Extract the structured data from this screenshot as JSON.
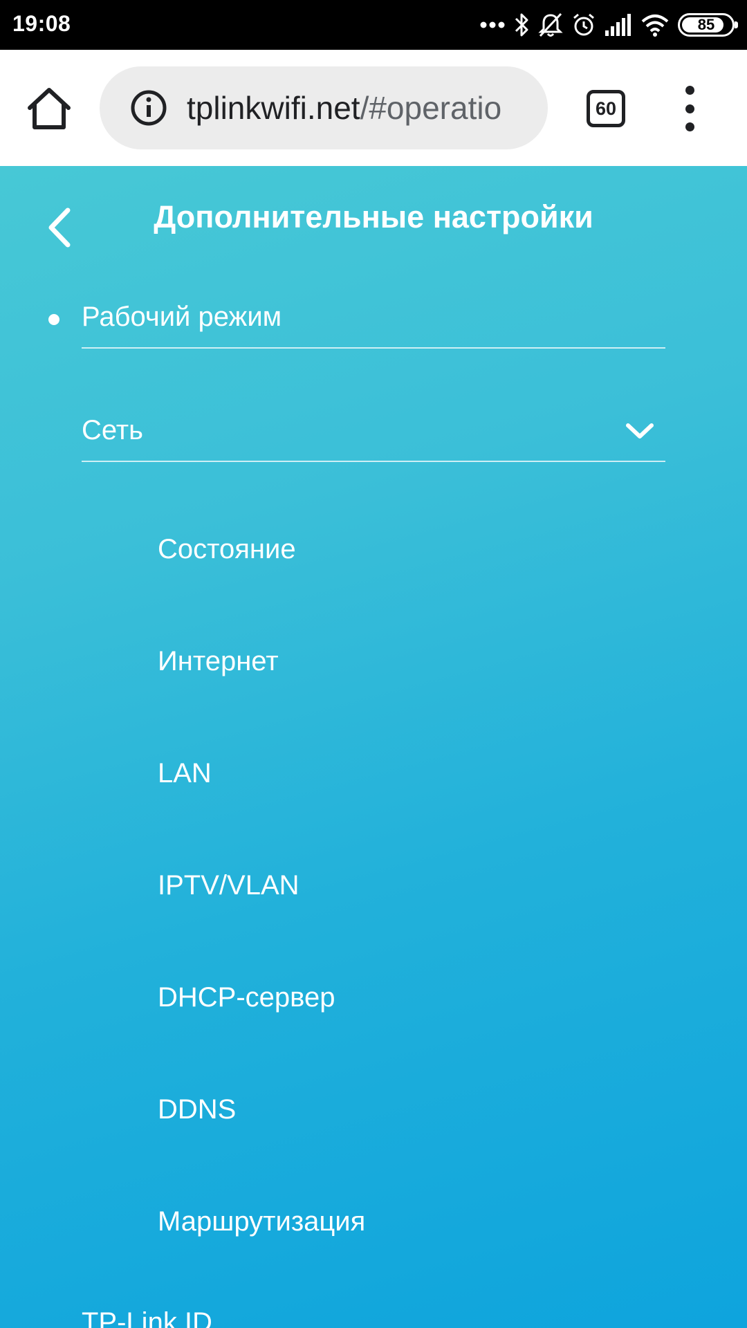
{
  "status_bar": {
    "time": "19:08",
    "battery_level": "85"
  },
  "browser": {
    "url_host": "tplinkwifi.net",
    "url_path": "/#operatio",
    "tab_count": "60"
  },
  "page": {
    "title": "Дополнительные настройки",
    "menu": {
      "operating_mode": "Рабочий режим",
      "network": "Сеть",
      "network_sub": [
        "Состояние",
        "Интернет",
        "LAN",
        "IPTV/VLAN",
        "DHCP-сервер",
        "DDNS",
        "Маршрутизация"
      ],
      "tp_link_id": "TP-Link ID"
    }
  },
  "colors": {
    "background_top": "#47c8d6",
    "background_bottom": "#0ea4dd",
    "status_bar": "#000000",
    "toolbar": "#ffffff"
  },
  "icons": [
    "home-icon",
    "info-icon",
    "overflow-menu-icon",
    "back-chevron-icon",
    "chevron-down-icon",
    "bluetooth-icon",
    "silent-icon",
    "alarm-icon",
    "signal-icon",
    "wifi-icon"
  ]
}
